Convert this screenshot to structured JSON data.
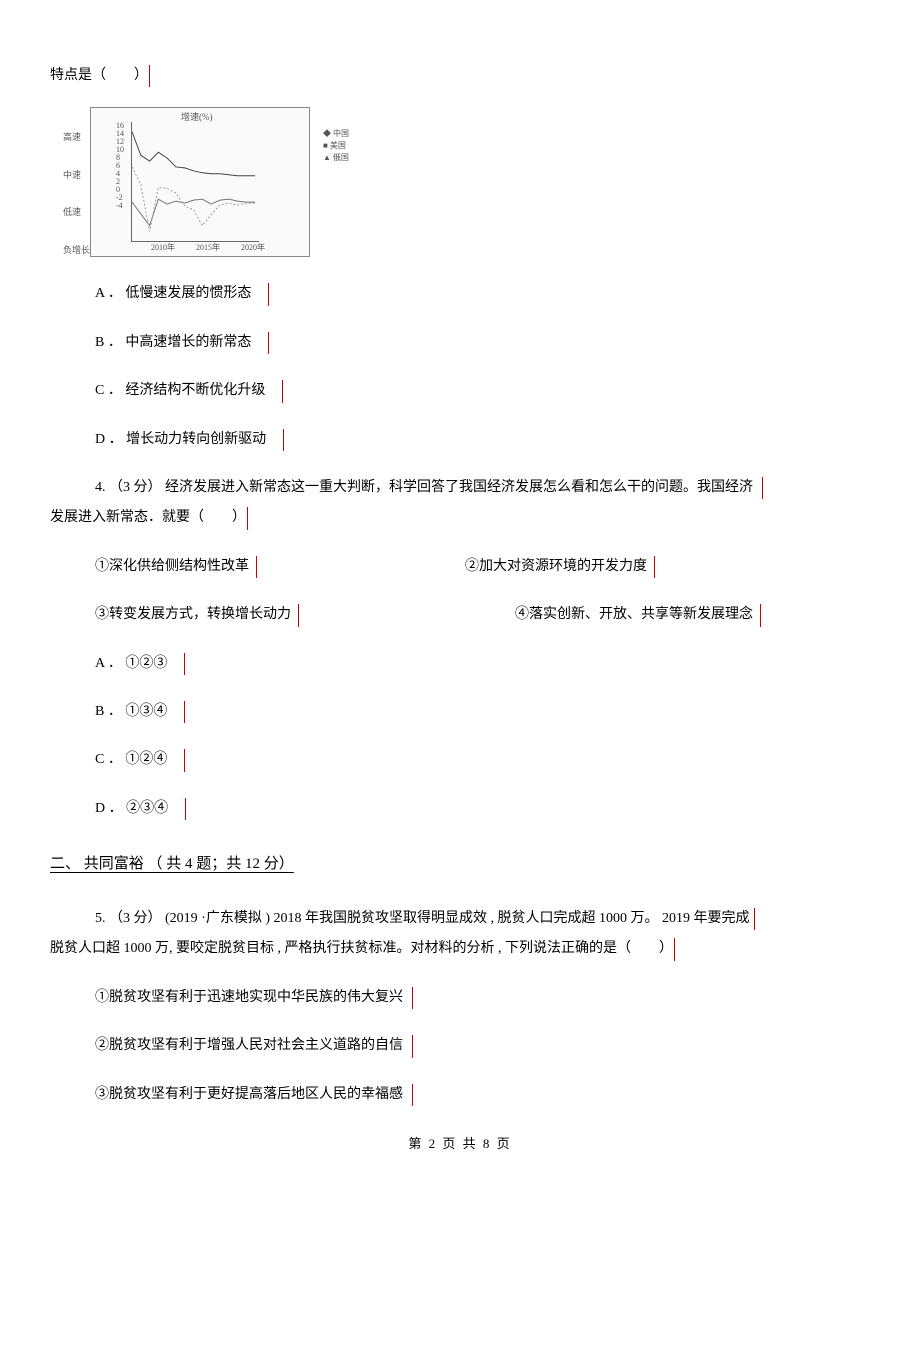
{
  "q3_continuation": "特点是（　　）",
  "chart_data": {
    "type": "line",
    "title": "增速(%)",
    "xlabel": "",
    "ylabel": "",
    "ylim": [
      -4,
      16
    ],
    "xlim": [
      2007,
      2022
    ],
    "y_categories": [
      "高速",
      "中速",
      "低速",
      "负增长"
    ],
    "ticks_y": [
      16,
      14,
      12,
      10,
      8,
      6,
      4,
      2,
      0,
      -2,
      -4
    ],
    "ticks_x": [
      "2010年",
      "2015年",
      "2020年"
    ],
    "legend": [
      "中国",
      "美国",
      "俄国"
    ],
    "series": [
      {
        "name": "中国",
        "x": [
          2007,
          2008,
          2009,
          2010,
          2011,
          2012,
          2013,
          2014,
          2015,
          2016,
          2017,
          2018,
          2019,
          2020,
          2021
        ],
        "y": [
          14,
          10,
          9,
          10.5,
          9.5,
          8,
          7.8,
          7.4,
          7,
          6.8,
          6.9,
          6.7,
          6.6,
          6.5,
          6.5
        ]
      },
      {
        "name": "美国",
        "x": [
          2007,
          2008,
          2009,
          2010,
          2011,
          2012,
          2013,
          2014,
          2015,
          2016,
          2017,
          2018,
          2019,
          2020,
          2021
        ],
        "y": [
          2,
          0,
          -2,
          2.5,
          1.6,
          2.2,
          1.8,
          2.4,
          2.6,
          1.6,
          2.3,
          2.5,
          2.2,
          2.0,
          2.0
        ]
      },
      {
        "name": "俄国",
        "x": [
          2007,
          2008,
          2009,
          2010,
          2011,
          2012,
          2013,
          2014,
          2015,
          2016,
          2017,
          2018,
          2019,
          2020,
          2021
        ],
        "y": [
          8,
          5,
          -3,
          4.5,
          4.3,
          3.5,
          1.3,
          0.7,
          -2,
          -0.2,
          1.5,
          1.8,
          1.5,
          1.8,
          1.8
        ]
      }
    ]
  },
  "q3": {
    "A": "A ． 低慢速发展的惯形态",
    "B": "B ． 中高速增长的新常态",
    "C": "C ． 经济结构不断优化升级",
    "D": "D ． 增长动力转向创新驱动"
  },
  "q4": {
    "stem_line1": "4.  （3 分）  经济发展进入新常态这一重大判断，科学回答了我国经济发展怎么看和怎么干的问题。我国经济",
    "stem_line2": "发展进入新常态．就要（　　）",
    "s1": "①深化供给侧结构性改革",
    "s2": "②加大对资源环境的开发力度",
    "s3": "③转变发展方式，转换增长动力",
    "s4": "④落实创新、开放、共享等新发展理念",
    "A": "A ． ①②③",
    "B": "B ． ①③④",
    "C": "C ． ①②④",
    "D": "D ． ②③④"
  },
  "section2_header": "二、  共同富裕 （ 共 4 题；共 12 分）",
  "q5": {
    "stem_line1": "5.  （3 分）  (2019 ·广东模拟  ) 2018  年我国脱贫攻坚取得明显成效   , 脱贫人口完成超   1000 万。 2019 年要完成",
    "stem_line2": "脱贫人口超  1000 万, 要咬定脱贫目标   , 严格执行扶贫标准。对材料的分析    , 下列说法正确的是（　　）",
    "s1": "①脱贫攻坚有利于迅速地实现中华民族的伟大复兴",
    "s2": "②脱贫攻坚有利于增强人民对社会主义道路的自信",
    "s3": "③脱贫攻坚有利于更好提高落后地区人民的幸福感"
  },
  "footer": "第 2 页 共 8 页"
}
